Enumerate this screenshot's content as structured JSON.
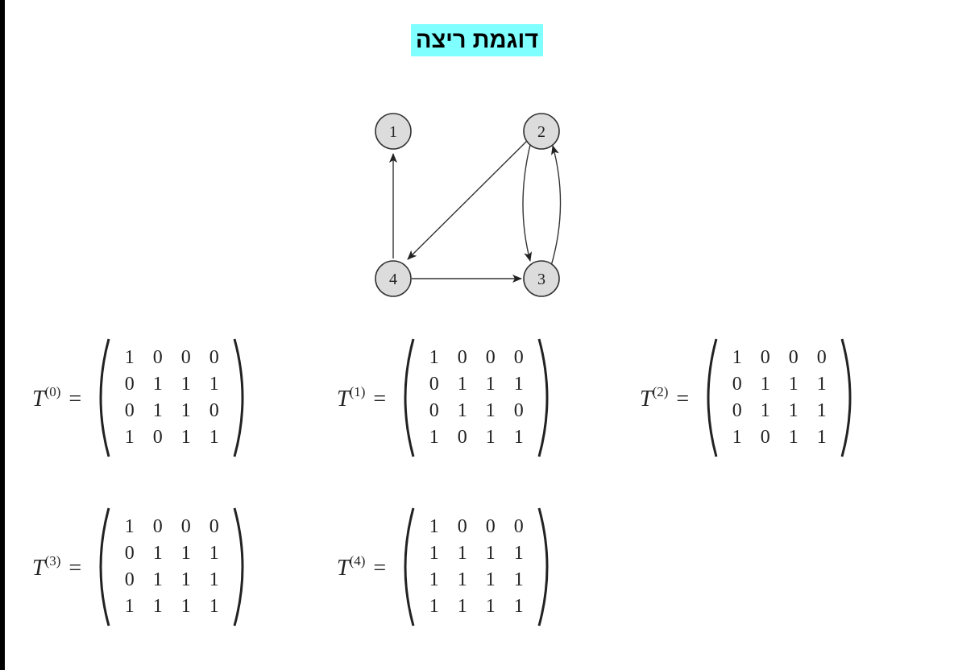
{
  "page": {
    "title": "דוגמת ריצה",
    "accent_color": "#7fffff",
    "border_color": "#000000"
  },
  "graph": {
    "nodes": [
      {
        "id": "1",
        "label": "1"
      },
      {
        "id": "2",
        "label": "2"
      },
      {
        "id": "3",
        "label": "3"
      },
      {
        "id": "4",
        "label": "4"
      }
    ],
    "edges": [
      {
        "from": "4",
        "to": "1"
      },
      {
        "from": "2",
        "to": "4"
      },
      {
        "from": "2",
        "to": "3"
      },
      {
        "from": "3",
        "to": "2"
      },
      {
        "from": "4",
        "to": "3"
      }
    ]
  },
  "matrices": [
    {
      "name": "T",
      "superscript": "(0)",
      "eq": "=",
      "rows": [
        [
          "1",
          "0",
          "0",
          "0"
        ],
        [
          "0",
          "1",
          "1",
          "1"
        ],
        [
          "0",
          "1",
          "1",
          "0"
        ],
        [
          "1",
          "0",
          "1",
          "1"
        ]
      ]
    },
    {
      "name": "T",
      "superscript": "(1)",
      "eq": "=",
      "rows": [
        [
          "1",
          "0",
          "0",
          "0"
        ],
        [
          "0",
          "1",
          "1",
          "1"
        ],
        [
          "0",
          "1",
          "1",
          "0"
        ],
        [
          "1",
          "0",
          "1",
          "1"
        ]
      ]
    },
    {
      "name": "T",
      "superscript": "(2)",
      "eq": "=",
      "rows": [
        [
          "1",
          "0",
          "0",
          "0"
        ],
        [
          "0",
          "1",
          "1",
          "1"
        ],
        [
          "0",
          "1",
          "1",
          "1"
        ],
        [
          "1",
          "0",
          "1",
          "1"
        ]
      ]
    },
    {
      "name": "T",
      "superscript": "(3)",
      "eq": "=",
      "rows": [
        [
          "1",
          "0",
          "0",
          "0"
        ],
        [
          "0",
          "1",
          "1",
          "1"
        ],
        [
          "0",
          "1",
          "1",
          "1"
        ],
        [
          "1",
          "1",
          "1",
          "1"
        ]
      ]
    },
    {
      "name": "T",
      "superscript": "(4)",
      "eq": "=",
      "rows": [
        [
          "1",
          "0",
          "0",
          "0"
        ],
        [
          "1",
          "1",
          "1",
          "1"
        ],
        [
          "1",
          "1",
          "1",
          "1"
        ],
        [
          "1",
          "1",
          "1",
          "1"
        ]
      ]
    }
  ]
}
